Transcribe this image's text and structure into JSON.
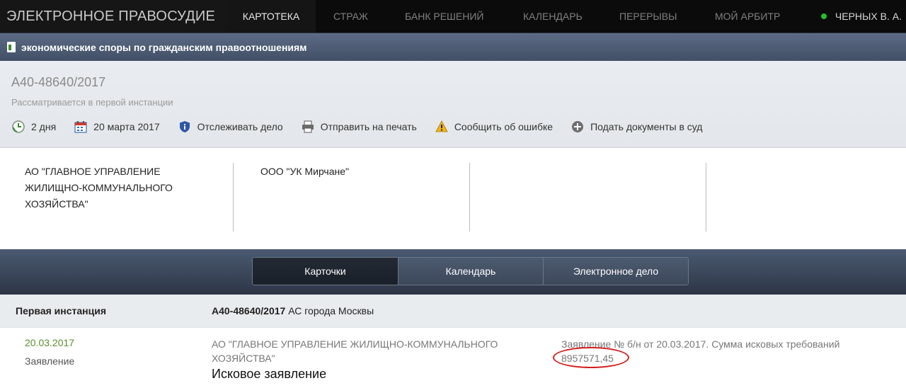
{
  "brand": "ЭЛЕКТРОННОЕ ПРАВОСУДИЕ",
  "nav": [
    "КАРТОТЕКА",
    "СТРАЖ",
    "БАНК РЕШЕНИЙ",
    "КАЛЕНДАРЬ",
    "ПЕРЕРЫВЫ",
    "МОЙ АРБИТР"
  ],
  "user": "ЧЕРНЫХ В. А.",
  "category": "экономические споры по гражданским правоотношениям",
  "case": {
    "number": "А40-48640/2017",
    "status": "Рассматривается в первой инстанции",
    "actions": {
      "days": "2 дня",
      "date": "20 марта 2017",
      "track": "Отслеживать дело",
      "print": "Отправить на печать",
      "report": "Сообщить об ошибке",
      "submit": "Подать документы в суд"
    }
  },
  "parties": {
    "plaintiff": "АО \"ГЛАВНОЕ УПРАВЛЕНИЕ ЖИЛИЩНО-КОММУНАЛЬНОГО ХОЗЯЙСТВА\"",
    "defendant": "ООО \"УК Мирчане\""
  },
  "tabs": [
    "Карточки",
    "Календарь",
    "Электронное дело"
  ],
  "instance": {
    "title": "Первая инстанция",
    "case_no": "А40-48640/2017",
    "court": "АС города Москвы"
  },
  "event": {
    "date": "20.03.2017",
    "type": "Заявление",
    "party": "АО \"ГЛАВНОЕ УПРАВЛЕНИЕ ЖИЛИЩНО-КОММУНАЛЬНОГО ХОЗЯЙСТВА\"",
    "doc": "Исковое заявление",
    "desc": "Заявление № б/н от 20.03.2017. Сумма исковых требований",
    "amount": "8957571,45"
  }
}
